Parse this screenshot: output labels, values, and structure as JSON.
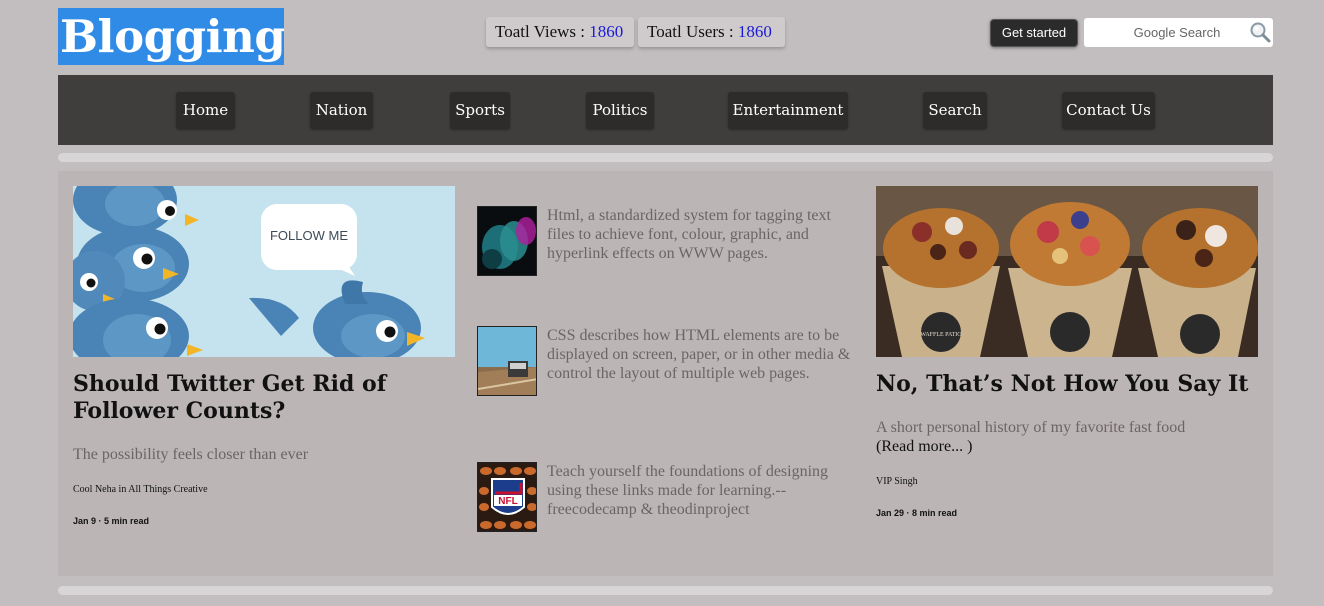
{
  "header": {
    "logo": "Blogging",
    "views_label": "Toatl Views : ",
    "views_value": "1860",
    "users_label": "Toatl Users : ",
    "users_value": "1860",
    "get_started": "Get started",
    "search_placeholder": "Google Search"
  },
  "nav": {
    "items": [
      {
        "label": "Home"
      },
      {
        "label": "Nation"
      },
      {
        "label": "Sports"
      },
      {
        "label": "Politics"
      },
      {
        "label": "Entertainment"
      },
      {
        "label": "Search"
      },
      {
        "label": "Contact Us"
      }
    ]
  },
  "left_card": {
    "image_text": "FOLLOW ME",
    "title": "Should Twitter Get Rid of Follower Counts?",
    "subtitle": "The possibility feels closer than ever",
    "author": "Cool Neha in All Things Creative",
    "date": "Jan 9 · 5 min read"
  },
  "middle": {
    "items": [
      {
        "text": "Html, a standardized system for tagging text files to achieve font, colour, graphic, and hyperlink effects on WWW pages."
      },
      {
        "text": "CSS describes how HTML elements are to be displayed on screen, paper, or in other media & control the layout of multiple web pages."
      },
      {
        "text": "Teach yourself the foundations of designing using these links made for learning.--freecodecamp & theodinproject"
      }
    ],
    "nfl_text": "NFL"
  },
  "right_card": {
    "title": "No, That’s Not How You Say It",
    "subtitle": "A short personal history of my favorite fast food",
    "read_more": "(Read more...  )",
    "author": "VIP Singh",
    "date": "Jan 29 · 8 min read",
    "cup_text": "WAFFLE PATIO"
  },
  "colors": {
    "background": "#c2bdbe",
    "logo_bg": "#2f8be6",
    "nav_bg": "#403d3d",
    "content_bg": "#bcb5b6",
    "stat_number": "#1a1ad6"
  }
}
